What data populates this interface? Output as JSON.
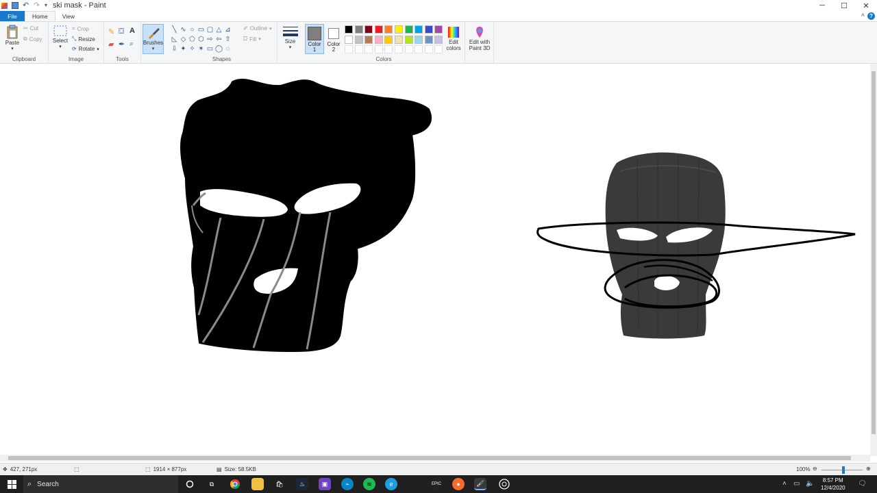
{
  "window": {
    "title": "ski mask - Paint",
    "controls": {
      "minimize": "─",
      "maximize": "☐",
      "close": "✕"
    }
  },
  "tabs": [
    {
      "label": "File"
    },
    {
      "label": "Home"
    },
    {
      "label": "View"
    }
  ],
  "ribbon": {
    "clipboard": {
      "group": "Clipboard",
      "paste": "Paste",
      "cut": "Cut",
      "copy": "Copy"
    },
    "image": {
      "group": "Image",
      "select": "Select",
      "crop": "Crop",
      "resize": "Resize",
      "rotate": "Rotate"
    },
    "tools": {
      "group": "Tools",
      "text_tool": "A"
    },
    "brushes": {
      "label": "Brushes"
    },
    "shapes": {
      "group": "Shapes",
      "outline": "Outline",
      "fill": "Fill",
      "glyphs": [
        "╲",
        "∿",
        "○",
        "▭",
        "▢",
        "△",
        "⊿",
        "◺",
        "◇",
        "⬠",
        "⬡",
        "⇨",
        "⇦",
        "⇧",
        "⇩",
        "✦",
        "✧",
        "✶",
        "▭",
        "◯",
        "◌"
      ]
    },
    "size": {
      "label": "Size"
    },
    "color1": {
      "label": "Color\n1",
      "color": "#7f7f7f"
    },
    "color2": {
      "label": "Color\n2",
      "color": "#ffffff"
    },
    "colors": {
      "group": "Colors",
      "edit_colors": "Edit colors",
      "edit_paint3d": "Edit with Paint 3D",
      "palette": [
        "#000000",
        "#7f7f7f",
        "#880015",
        "#ed1c24",
        "#ff7f27",
        "#fff200",
        "#22b14c",
        "#00a2e8",
        "#3f48cc",
        "#a349a4",
        "#ffffff",
        "#c3c3c3",
        "#b97a57",
        "#ffaec9",
        "#ffc90e",
        "#efe4b0",
        "#b5e61d",
        "#99d9ea",
        "#7092be",
        "#c8bfe7",
        "#ffffff",
        "#ffffff",
        "#ffffff",
        "#ffffff",
        "#ffffff",
        "#ffffff",
        "#ffffff",
        "#ffffff",
        "#ffffff",
        "#ffffff"
      ]
    }
  },
  "status": {
    "cursor": "427, 271px",
    "canvas_size": "1914 × 877px",
    "file_size": "Size: 58.5KB",
    "zoom": "100%"
  },
  "taskbar": {
    "search_placeholder": "Search",
    "time": "8:57 PM",
    "date": "12/4/2020"
  }
}
